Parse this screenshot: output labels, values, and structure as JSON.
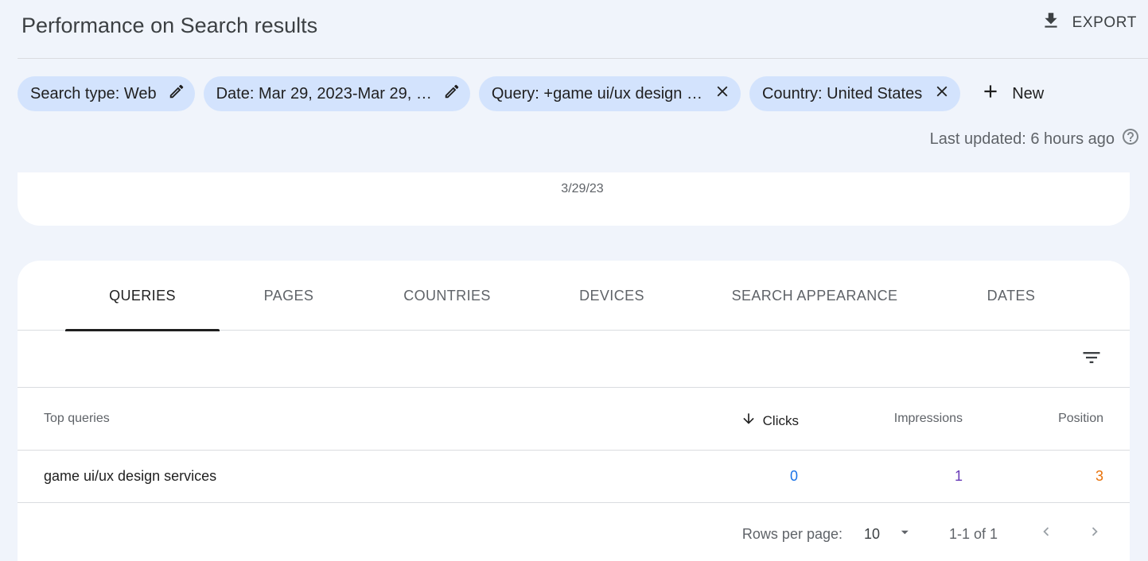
{
  "header": {
    "title": "Performance on Search results",
    "export_label": "EXPORT"
  },
  "filters": {
    "chips": [
      {
        "label": "Search type: Web",
        "action": "edit"
      },
      {
        "label": "Date: Mar 29, 2023-Mar 29, …",
        "action": "edit"
      },
      {
        "label": "Query: +game ui/ux design …",
        "action": "remove"
      },
      {
        "label": "Country: United States",
        "action": "remove"
      }
    ],
    "new_label": "New"
  },
  "status": {
    "last_updated": "Last updated: 6 hours ago"
  },
  "chart": {
    "x_label": "3/29/23"
  },
  "tabs": [
    {
      "label": "QUERIES",
      "active": true
    },
    {
      "label": "PAGES",
      "active": false
    },
    {
      "label": "COUNTRIES",
      "active": false
    },
    {
      "label": "DEVICES",
      "active": false
    },
    {
      "label": "SEARCH APPEARANCE",
      "active": false
    },
    {
      "label": "DATES",
      "active": false
    }
  ],
  "table": {
    "columns": {
      "query": "Top queries",
      "clicks": "Clicks",
      "impressions": "Impressions",
      "position": "Position"
    },
    "sort_column": "clicks",
    "sort_direction": "descending",
    "rows": [
      {
        "query": "game ui/ux design services",
        "clicks": "0",
        "impressions": "1",
        "position": "3"
      }
    ]
  },
  "pagination": {
    "rows_per_page_label": "Rows per page:",
    "rows_per_page_value": "10",
    "range": "1-1 of 1"
  },
  "colors": {
    "chip_background": "#d3e3fd",
    "page_background": "#f0f4fb",
    "clicks_color": "#1a73e8",
    "impressions_color": "#673ab7",
    "position_color": "#e8710a"
  }
}
